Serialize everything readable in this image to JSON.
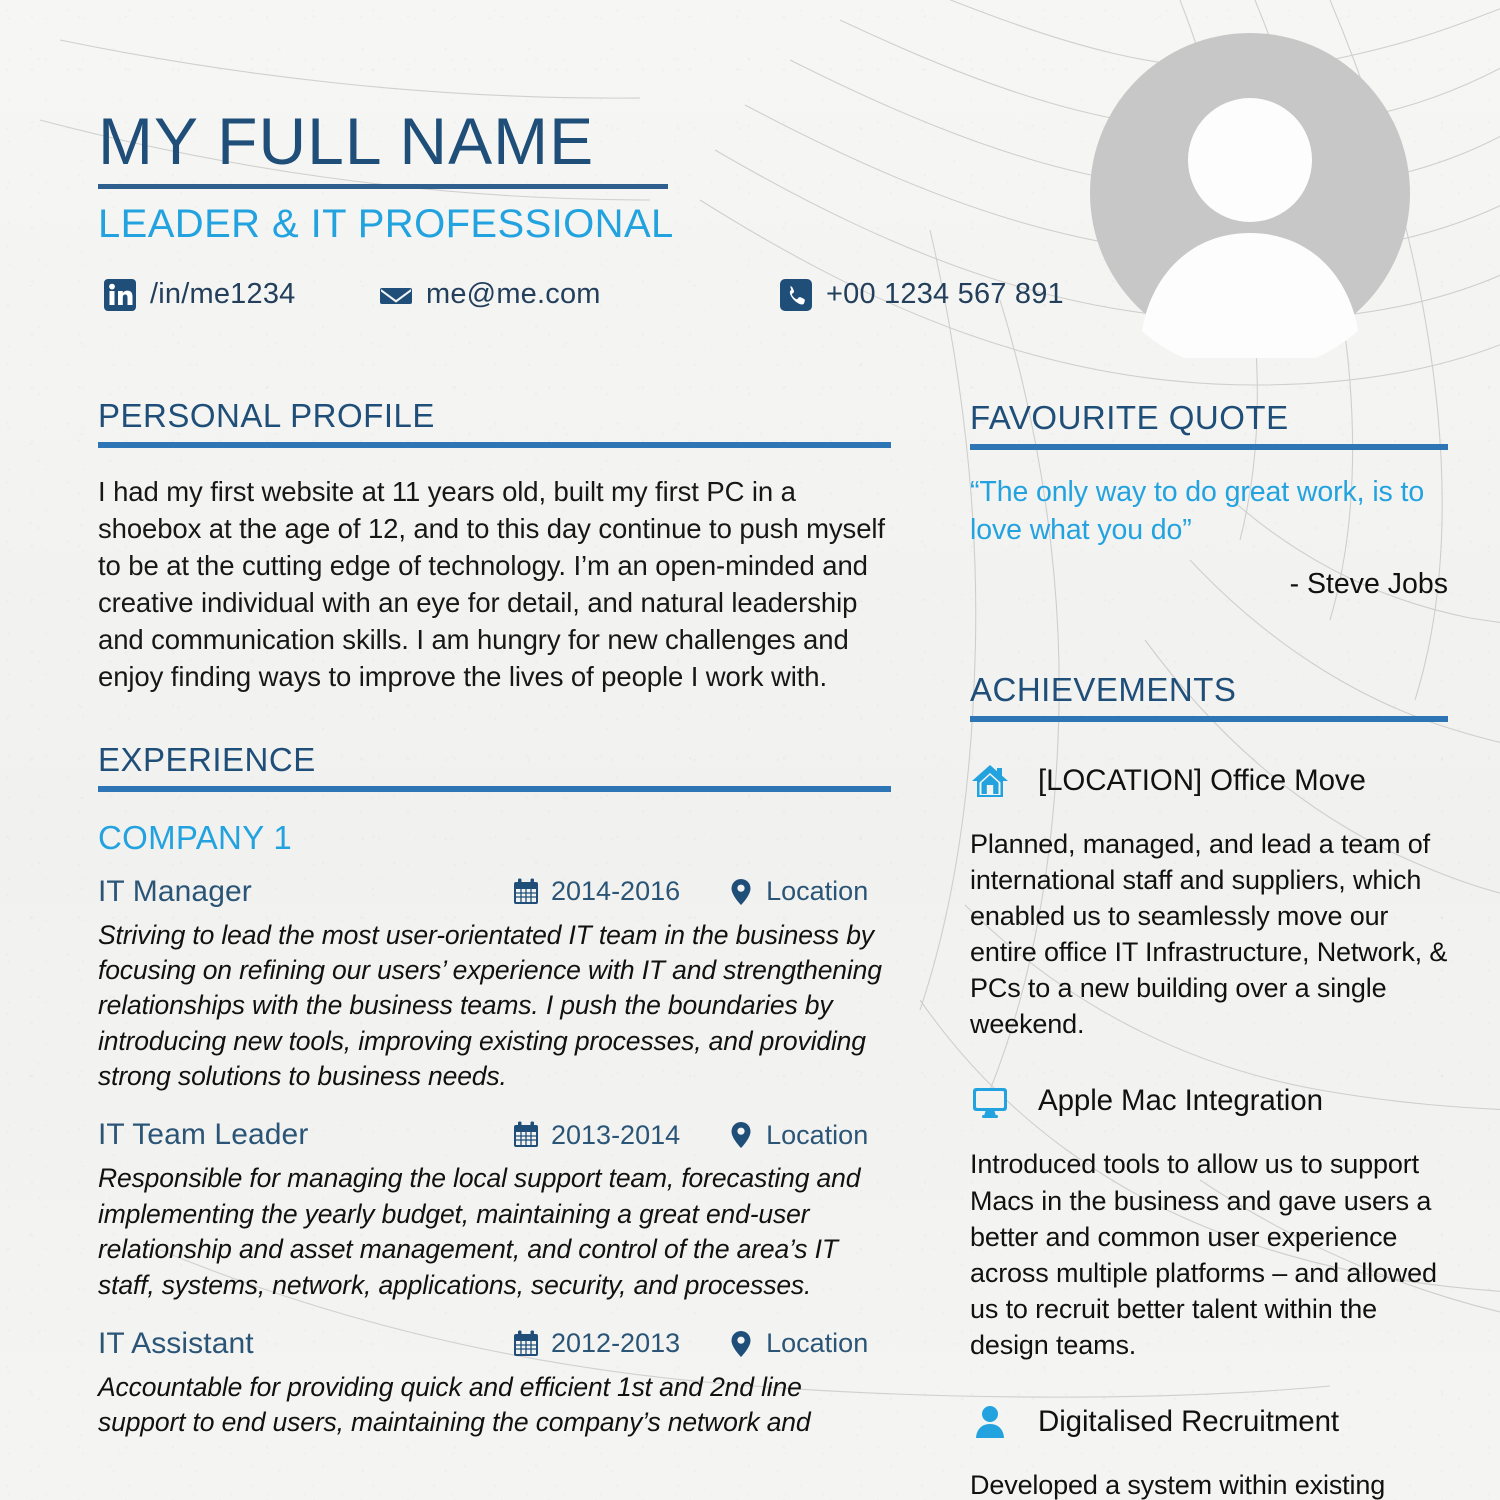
{
  "header": {
    "full_name": "MY FULL NAME",
    "tagline": "LEADER & IT PROFESSIONAL",
    "contacts": [
      {
        "icon": "linkedin-icon",
        "text": "/in/me1234"
      },
      {
        "icon": "email-icon",
        "text": "me@me.com"
      },
      {
        "icon": "phone-icon",
        "text": "+00 1234 567 891"
      }
    ],
    "avatar_alt": "avatar-placeholder"
  },
  "colors": {
    "navy": "#1f4e79",
    "rule_blue": "#2e75b6",
    "cyan": "#22a3e0",
    "role_blue": "#2b5577",
    "body_text": "#111111",
    "paper": "#f3f3f1",
    "avatar_grey": "#c8c8c8"
  },
  "sections": {
    "personal_profile": {
      "heading": "PERSONAL PROFILE",
      "text": "I had my first website at 11 years old, built my first PC in a shoebox at the age of 12, and to this day continue to push myself to be at the cutting edge of technology. I’m an open-minded and creative individual with an eye for detail, and natural leadership and communication skills. I am hungry for new challenges and enjoy finding ways to improve the lives of people I work with."
    },
    "experience": {
      "heading": "EXPERIENCE",
      "company": "COMPANY 1",
      "roles": [
        {
          "title": "IT Manager",
          "dates": "2014-2016",
          "location": "Location",
          "description": "Striving to lead the most user-orientated IT team in the business by focusing on refining our users’ experience with IT and strengthening relationships with the business teams. I push the boundaries by introducing new tools, improving existing processes, and providing strong solutions to business needs."
        },
        {
          "title": "IT Team Leader",
          "dates": "2013-2014",
          "location": "Location",
          "description": "Responsible for managing the local support team, forecasting and implementing the yearly budget, maintaining a great end-user relationship and asset management, and control of the area’s IT staff, systems, network, applications, security, and processes."
        },
        {
          "title": "IT Assistant",
          "dates": "2012-2013",
          "location": "Location",
          "description": "Accountable for providing quick and efficient 1st and 2nd line support to end users, maintaining the company’s network and"
        }
      ]
    },
    "favourite_quote": {
      "heading": "FAVOURITE QUOTE",
      "quote": "“The only way to do great work, is to love what you do”",
      "author": "- Steve Jobs"
    },
    "achievements": {
      "heading": "ACHIEVEMENTS",
      "items": [
        {
          "icon": "home-icon",
          "title": "[LOCATION] Office Move",
          "body": "Planned, managed, and lead a team of international staff and suppliers, which enabled us to seamlessly move our entire office IT Infrastructure, Network, & PCs to a new building over a single weekend."
        },
        {
          "icon": "monitor-icon",
          "title": "Apple Mac Integration",
          "body": "Introduced tools to allow us to support Macs in the business and gave users a better and common user experience across multiple platforms – and allowed us to recruit better talent within the design teams."
        },
        {
          "icon": "person-icon",
          "title": "Digitalised Recruitment",
          "body": "Developed a system within existing"
        }
      ]
    }
  }
}
